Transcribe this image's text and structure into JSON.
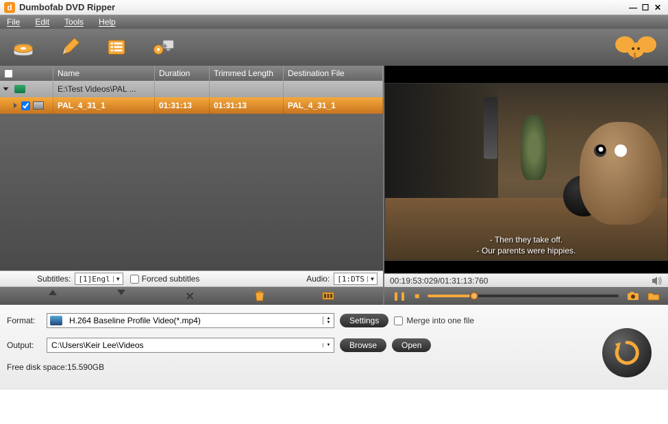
{
  "app": {
    "title": "Dumbofab DVD Ripper"
  },
  "menu": {
    "file": "File",
    "edit": "Edit",
    "tools": "Tools",
    "help": "Help"
  },
  "columns": {
    "name": "Name",
    "duration": "Duration",
    "trimmed": "Trimmed Length",
    "dest": "Destination File"
  },
  "tree": {
    "parent": {
      "name": "E:\\Test Videos\\PAL ..."
    },
    "child": {
      "name": "PAL_4_31_1",
      "duration": "01:31:13",
      "trimmed": "01:31:13",
      "dest": "PAL_4_31_1"
    }
  },
  "subs": {
    "label": "Subtitles:",
    "value": "[1]Engl",
    "forced_label": "Forced subtitles",
    "audio_label": "Audio:",
    "audio_value": "[1:DTS"
  },
  "preview": {
    "subtitle1": "- Then they take off.",
    "subtitle2": "- Our parents were hippies.",
    "time": "00:19:53:029/01:31:13:760"
  },
  "format": {
    "label": "Format:",
    "value": "H.264 Baseline Profile Video(*.mp4)",
    "settings": "Settings",
    "merge": "Merge into one file"
  },
  "output": {
    "label": "Output:",
    "value": "C:\\Users\\Keir Lee\\Videos",
    "browse": "Browse",
    "open": "Open"
  },
  "status": {
    "freedisk": "Free disk space:15.590GB"
  }
}
